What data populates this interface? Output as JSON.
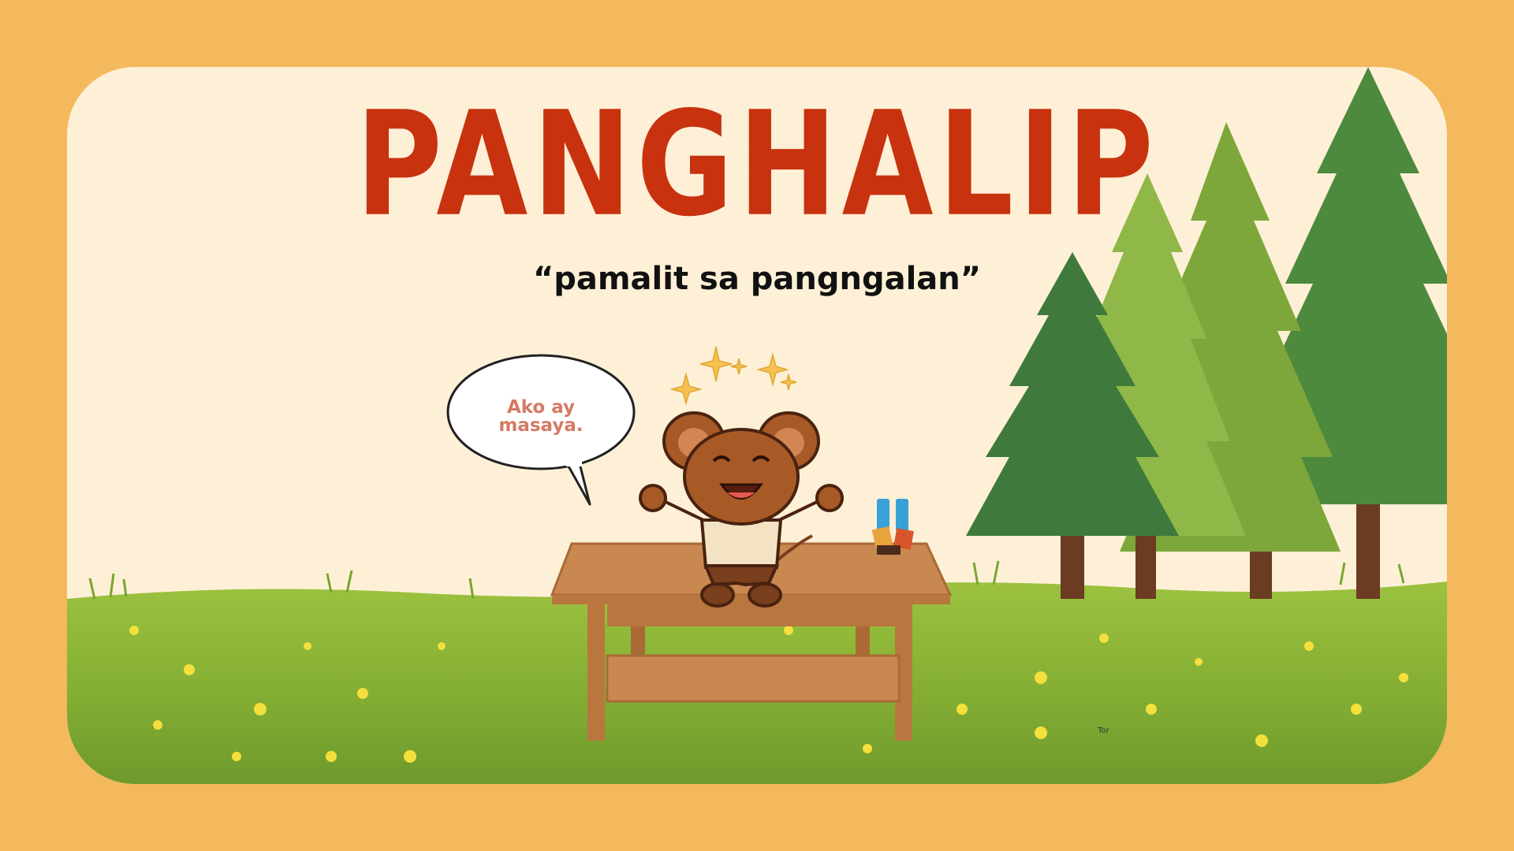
{
  "slide": {
    "title": "PANGHALIP",
    "subtitle": "“pamalit sa pangngalan”",
    "speech_bubble": "Ako ay masaya."
  },
  "colors": {
    "outer_background": "#f4b95c",
    "card_background": "#fdf0d6",
    "title": "#c8320f",
    "subtitle": "#111111",
    "bubble_text": "#d47a63",
    "grass": "#8bb436",
    "trees": [
      "#3f7a3c",
      "#7ea73b",
      "#4e8a3e"
    ],
    "table": "#c98850",
    "mouse": "#a85a26"
  },
  "icons": [
    "sparkle-icon",
    "water-bottle-icon",
    "snack-pack-icon"
  ]
}
